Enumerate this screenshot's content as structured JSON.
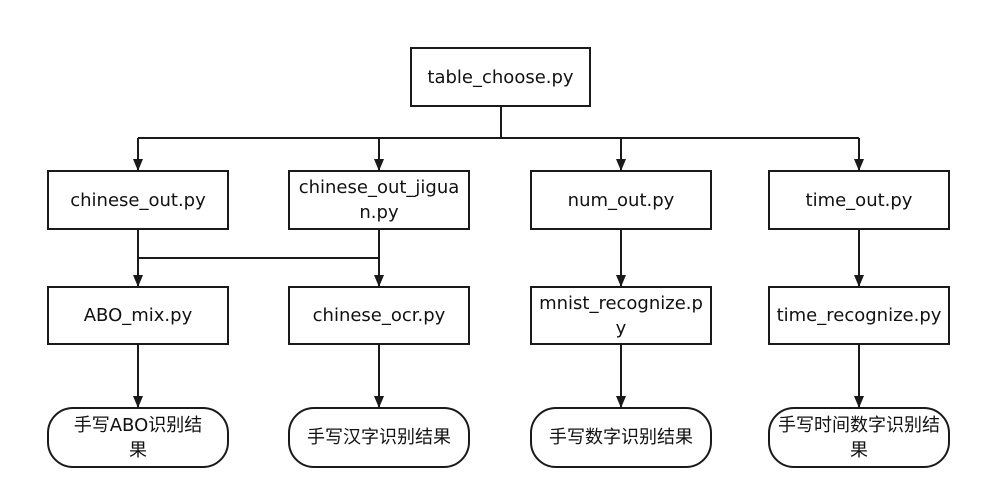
{
  "nodes": {
    "table_choose": "table_choose.py",
    "chinese_out": "chinese_out.py",
    "chinese_out_jiguan": "chinese_out_jiguan.py",
    "num_out": "num_out.py",
    "time_out": "time_out.py",
    "abo_mix": "ABO_mix.py",
    "chinese_ocr": "chinese_ocr.py",
    "mnist_recognize": "mnist_recognize.py",
    "time_recognize": "time_recognize.py"
  },
  "results": {
    "abo": "手写ABO识别结果",
    "hanzi": "手写汉字识别结果",
    "shuzi": "手写数字识别结果",
    "time": "手写时间数字识别结果"
  },
  "colors": {
    "line": "#1a1a1a",
    "background": "#ffffff"
  }
}
